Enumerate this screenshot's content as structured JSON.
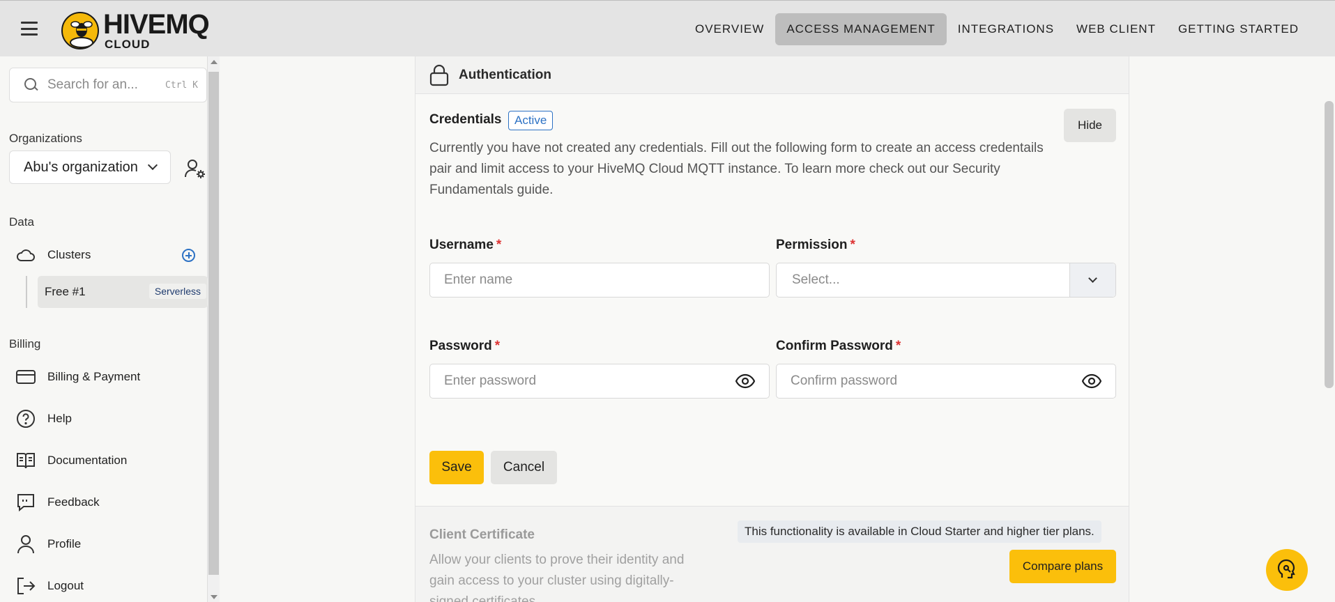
{
  "header": {
    "logo_main": "HIVEMQ",
    "logo_sub": "CLOUD",
    "nav": [
      {
        "label": "OVERVIEW"
      },
      {
        "label": "ACCESS MANAGEMENT"
      },
      {
        "label": "INTEGRATIONS"
      },
      {
        "label": "WEB CLIENT"
      },
      {
        "label": "GETTING STARTED"
      }
    ],
    "active_nav": "ACCESS MANAGEMENT"
  },
  "sidebar": {
    "search_placeholder": "Search for an...",
    "search_shortcut": "Ctrl K",
    "organizations_label": "Organizations",
    "organization_selected": "Abu's organization",
    "data_label": "Data",
    "clusters_label": "Clusters",
    "cluster_item": {
      "name": "Free #1",
      "badge": "Serverless"
    },
    "billing_label": "Billing",
    "items": [
      {
        "label": "Billing & Payment",
        "icon": "credit-card-icon"
      },
      {
        "label": "Help",
        "icon": "help-circle-icon"
      },
      {
        "label": "Documentation",
        "icon": "book-icon"
      },
      {
        "label": "Feedback",
        "icon": "feedback-icon"
      },
      {
        "label": "Profile",
        "icon": "user-icon"
      },
      {
        "label": "Logout",
        "icon": "logout-icon"
      }
    ]
  },
  "panel": {
    "title": "Authentication",
    "credentials_title": "Credentials",
    "credentials_status": "Active",
    "hide_label": "Hide",
    "description": "Currently you have not created any credentials. Fill out the following form to create an access credentails pair and limit access to your HiveMQ Cloud MQTT instance. To learn more check out our Security Fundamentals guide.",
    "form": {
      "username_label": "Username",
      "username_placeholder": "Enter name",
      "permission_label": "Permission",
      "permission_placeholder": "Select...",
      "password_label": "Password",
      "password_placeholder": "Enter password",
      "confirm_label": "Confirm Password",
      "confirm_placeholder": "Confirm password",
      "required_mark": "*"
    },
    "save_label": "Save",
    "cancel_label": "Cancel",
    "client_certificate": {
      "title": "Client Certificate",
      "description": "Allow your clients to prove their identity and gain access to your cluster using digitally-signed certificates.",
      "note": "This functionality is available in Cloud Starter and higher tier plans.",
      "compare_label": "Compare plans"
    }
  },
  "colors": {
    "accent": "#fbbf0b",
    "link_blue": "#2d72c4",
    "required_red": "#dd3333"
  }
}
